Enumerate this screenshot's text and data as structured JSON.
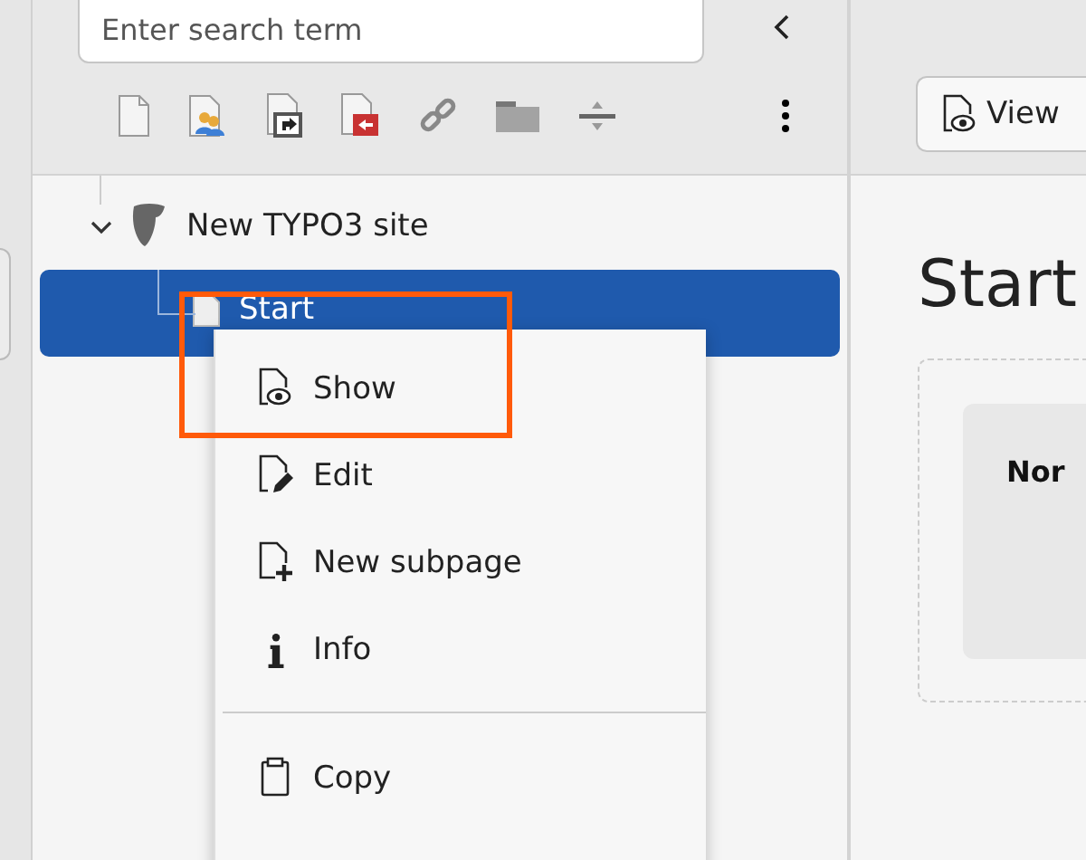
{
  "search": {
    "placeholder": "Enter search term"
  },
  "tree": [
    {
      "label": "New TYPO3 site",
      "expanded": true,
      "selected": false,
      "children": [
        {
          "label": "Start",
          "selected": true
        }
      ]
    }
  ],
  "context_menu": {
    "items": [
      {
        "kind": "item",
        "label": "Show",
        "highlighted": true
      },
      {
        "kind": "item",
        "label": "Edit",
        "highlighted": false
      },
      {
        "kind": "item",
        "label": "New subpage",
        "highlighted": false
      },
      {
        "kind": "item",
        "label": "Info",
        "highlighted": false
      },
      {
        "kind": "divider"
      },
      {
        "kind": "item",
        "label": "Copy",
        "highlighted": false
      }
    ]
  },
  "content": {
    "view_button": "View",
    "title": "Start",
    "card": {
      "heading": "Nor"
    }
  }
}
